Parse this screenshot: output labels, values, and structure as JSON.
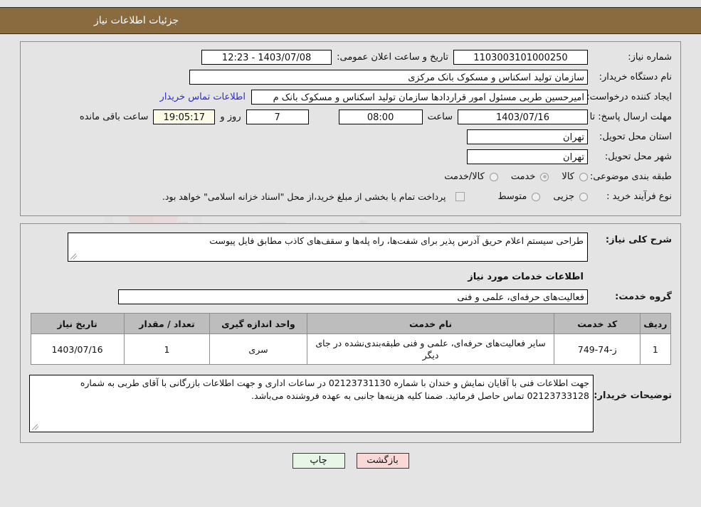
{
  "header": {
    "title": "جزئیات اطلاعات نیاز"
  },
  "top_form": {
    "need_number_label": "شماره نیاز:",
    "need_number_value": "1103003101000250",
    "announce_label": "تاریخ و ساعت اعلان عمومی:",
    "announce_value": "1403/07/08 - 12:23",
    "buyer_org_label": "نام دستگاه خریدار:",
    "buyer_org_value": "سازمان تولید اسکناس و مسکوک بانک مرکزی",
    "creator_label": "ایجاد کننده درخواست:",
    "creator_value": "امیرحسین طربی مسئول امور قراردادها سازمان تولید اسکناس و مسکوک بانک م",
    "contact_link": "اطلاعات تماس خریدار",
    "deadline_label": "مهلت ارسال پاسخ: تا تاریخ:",
    "deadline_date": "1403/07/16",
    "time_label": "ساعت",
    "deadline_time": "08:00",
    "days_value": "7",
    "days_label": "روز و",
    "remaining_value": "19:05:17",
    "remaining_label": "ساعت باقی مانده",
    "province_label": "استان محل تحویل:",
    "province_value": "تهران",
    "city_label": "شهر محل تحویل:",
    "city_value": "تهران",
    "category_label": "طبقه بندی موضوعی:",
    "category_options": [
      {
        "label": "کالا",
        "selected": false
      },
      {
        "label": "خدمت",
        "selected": true
      },
      {
        "label": "کالا/خدمت",
        "selected": false
      }
    ],
    "process_label": "نوع فرآیند خرید :",
    "process_options": [
      {
        "label": "جزیی",
        "selected": false
      },
      {
        "label": "متوسط",
        "selected": false
      }
    ],
    "treasury_checkbox_checked": false,
    "treasury_note": "پرداخت تمام یا بخشی از مبلغ خرید،از محل \"اسناد خزانه اسلامی\" خواهد بود."
  },
  "detail": {
    "need_desc_label": "شرح کلی نیاز:",
    "need_desc_value": "طراحی سیستم اعلام حریق آدرس پذیر برای شفت‌ها، راه پله‌ها و سقف‌های کاذب مطابق فایل پیوست",
    "services_section_title": "اطلاعات خدمات مورد نیاز",
    "service_group_label": "گروه خدمت:",
    "service_group_value": "فعالیت‌های حرفه‌ای، علمی و فنی",
    "table": {
      "headers": [
        "ردیف",
        "کد خدمت",
        "نام خدمت",
        "واحد اندازه گیری",
        "تعداد / مقدار",
        "تاریخ نیاز"
      ],
      "rows": [
        {
          "radif": "1",
          "code": "ز-74-749",
          "name": "سایر فعالیت‌های حرفه‌ای، علمی و فنی طبقه‌بندی‌نشده در جای دیگر",
          "unit": "سری",
          "qty": "1",
          "date": "1403/07/16"
        }
      ]
    },
    "buyer_notes_label": "توضیحات خریدار:",
    "buyer_notes_value": "جهت اطلاعات فنی با آقایان نمایش و خندان با شماره 02123731130 در ساعات اداری و جهت اطلاعات بازرگانی با آقای طربی به شماره 02123733128 تماس حاصل فرمائید. ضمنا کلیه هزینه‌ها جانبی به عهده فروشنده می‌باشد."
  },
  "footer": {
    "print_label": "چاپ",
    "back_label": "بازگشت"
  },
  "watermark": {
    "text_left": "Ana",
    "text_right": "Tender.net"
  },
  "colors": {
    "title_bar": "#8a6b3f",
    "page_bg": "#e4e4e4",
    "link": "#2b2bcf",
    "table_header": "#bdbdbd",
    "btn_print": "#e8f6e8",
    "btn_back": "#fbd8d8",
    "highlight_field": "#fbfbe6"
  }
}
